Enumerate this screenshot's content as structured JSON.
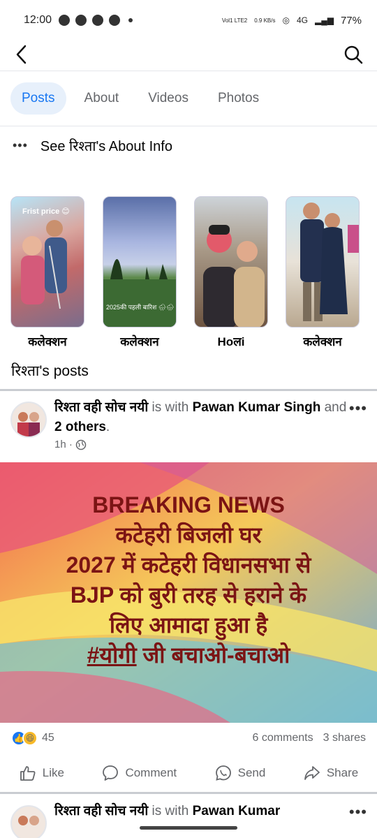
{
  "status_bar": {
    "time": "12:00",
    "network_small": "Vol1 LTE2",
    "speed": "0.9 KB/s",
    "network": "4G",
    "battery": "77%"
  },
  "tabs": [
    {
      "label": "Posts",
      "active": true
    },
    {
      "label": "About"
    },
    {
      "label": "Videos"
    },
    {
      "label": "Photos"
    }
  ],
  "about_link": "See रिश्ता's About Info",
  "collections": [
    {
      "label": "कलेक्शन",
      "overlay": "Frist price 😊"
    },
    {
      "label": "कलेक्शन",
      "overlay": "2025की पहली बारिश 🌧🌧"
    },
    {
      "label": "Hoलi",
      "overlay": ""
    },
    {
      "label": "कलेक्शन",
      "overlay": ""
    }
  ],
  "posts_title": "रिश्ता's posts",
  "post1": {
    "author": "रिश्ता वही सोच नयी",
    "with_text": " is with ",
    "tagged": "Pawan Kumar Singh",
    "and_text": " and ",
    "others": "2 others",
    "period": ".",
    "time": "1h ·",
    "image_lines": [
      "BREAKING NEWS",
      "कटेहरी बिजली घर",
      "2027 में कटेहरी विधानसभा से",
      "BJP को बुरी तरह से हराने के",
      "लिए आमादा हुआ है",
      "#योगी जी बचाओ-बचाओ"
    ],
    "reaction_count": "45",
    "comments": "6 comments",
    "shares": "3 shares"
  },
  "actions": {
    "like": "Like",
    "comment": "Comment",
    "send": "Send",
    "share": "Share"
  },
  "post2": {
    "author": "रिश्ता वही सोच नयी",
    "with_text": " is with ",
    "tagged": "Pawan Kumar"
  },
  "colors": {
    "accent": "#1877f2",
    "tab_active_bg": "#e7f0fb",
    "breaking_text": "#7b1414"
  }
}
